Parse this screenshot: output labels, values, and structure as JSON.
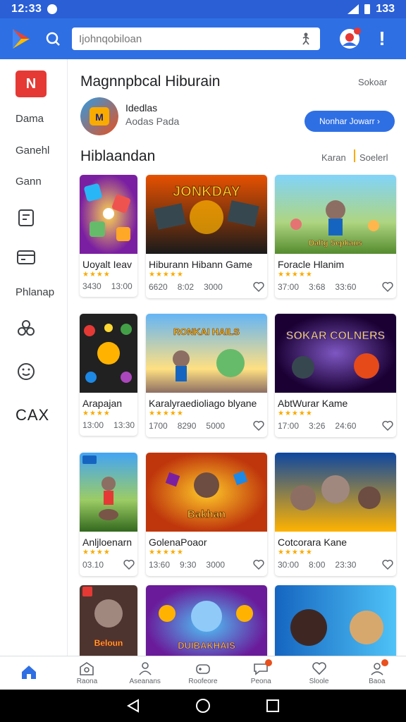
{
  "status_bar": {
    "time": "12:33",
    "battery": "133"
  },
  "app_bar": {
    "search_placeholder": "Ijohnqobiloan"
  },
  "sidebar": {
    "logo_text": "N",
    "items": [
      "Dama",
      "Ganehl",
      "Gann",
      "Phlanap"
    ],
    "bottom_label": "CAX"
  },
  "featured": {
    "section_title": "Magnnpbcal Hiburain",
    "section_action": "Sokoar",
    "app_title": "Idedlas",
    "app_subtitle": "Aodas Pada",
    "button_label": "Nonhar Jowarr ›"
  },
  "grid": {
    "section_title": "Hiblaandan",
    "tab_a": "Karan",
    "tab_b": "Soelerl",
    "rows": [
      [
        {
          "title": "Uoyalt Ieav",
          "stars": "★★★★",
          "meta": [
            "3430",
            "13:00"
          ]
        },
        {
          "title": "Hiburann Hibann Game",
          "stars": "★★★★★",
          "meta": [
            "6620",
            "8:02",
            "3000"
          ]
        },
        {
          "title": "Foracle Hlanim",
          "stars": "★★★★★",
          "meta": [
            "37:00",
            "3:68",
            "33:60"
          ]
        }
      ],
      [
        {
          "title": "Arapajan",
          "stars": "★★★★",
          "meta": [
            "13:00",
            "13:30"
          ]
        },
        {
          "title": "Karalyraedioliago blyane",
          "stars": "★★★★★",
          "meta": [
            "1700",
            "8290",
            "5000"
          ]
        },
        {
          "title": "AbtWurar Kame",
          "stars": "★★★★★",
          "meta": [
            "17:00",
            "3:26",
            "24:60"
          ]
        }
      ],
      [
        {
          "title": "Anljloenarn",
          "stars": "★★★★",
          "meta": [
            "03.10"
          ]
        },
        {
          "title": "GolenaPoaor",
          "stars": "★★★★★",
          "meta": [
            "13:60",
            "9:30",
            "3000"
          ]
        },
        {
          "title": "Cotcorara Kane",
          "stars": "★★★★★",
          "meta": [
            "30:00",
            "8:00",
            "23:30"
          ]
        }
      ]
    ],
    "thumb_texts": [
      "JONKDAY",
      "Daltg Sepkaus",
      "RONKAI HAILS",
      "SOKAR COLNERS",
      "Bakhan",
      "Beloun",
      "DUIBAKHAIS"
    ]
  },
  "bottom_nav": [
    "Home",
    "Raona",
    "Aseanans",
    "Roofeore",
    "Peona",
    "Sloole",
    "Baoa"
  ],
  "colors": {
    "primary": "#2f6fe4",
    "status": "#2a5fd6",
    "star": "#f9ab00",
    "badge": "#e53935"
  }
}
